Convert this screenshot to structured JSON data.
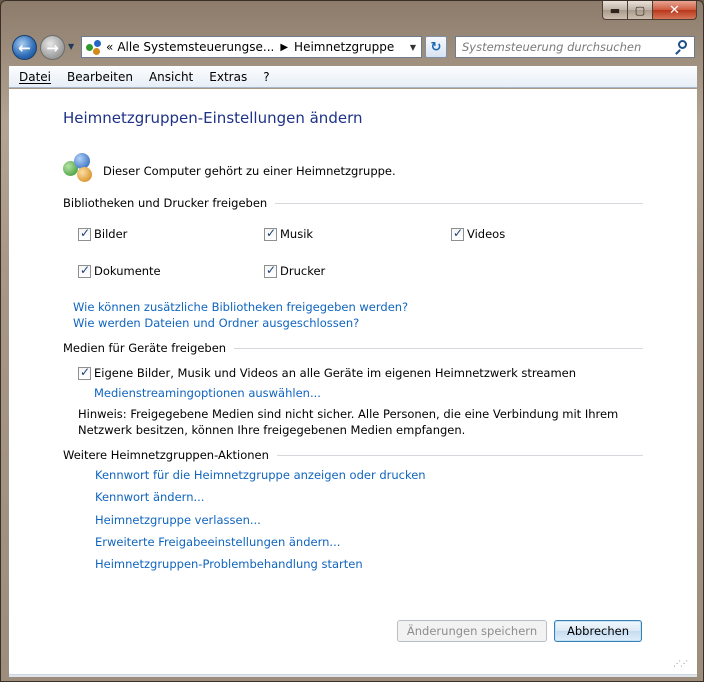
{
  "window": {
    "caption_buttons": {
      "minimize": "▬",
      "maximize": "▢",
      "close": "✕"
    }
  },
  "nav": {
    "back_icon": "←",
    "forward_icon": "→",
    "dropdown_icon": "▼",
    "address": {
      "overflow_marker": "«",
      "crumbs": [
        "Alle Systemsteuerungse...",
        "Heimnetzgruppe"
      ],
      "separator": "▶",
      "dropdown_icon": "▼"
    },
    "refresh_icon": "↻",
    "search": {
      "placeholder": "Systemsteuerung durchsuchen"
    }
  },
  "menubar": {
    "items": [
      "Datei",
      "Bearbeiten",
      "Ansicht",
      "Extras",
      "?"
    ]
  },
  "page": {
    "title": "Heimnetzgruppen-Einstellungen ändern",
    "status_text": "Dieser Computer gehört zu einer Heimnetzgruppe.",
    "sections": {
      "libraries": "Bibliotheken und Drucker freigeben",
      "media": "Medien für Geräte freigeben",
      "actions": "Weitere Heimnetzgruppen-Aktionen"
    },
    "share_items": [
      {
        "label": "Bilder",
        "checked": true
      },
      {
        "label": "Musik",
        "checked": true
      },
      {
        "label": "Videos",
        "checked": true
      },
      {
        "label": "Dokumente",
        "checked": true
      },
      {
        "label": "Drucker",
        "checked": true
      }
    ],
    "library_links": [
      "Wie können zusätzliche Bibliotheken freigegeben werden?",
      "Wie werden Dateien und Ordner ausgeschlossen?"
    ],
    "media_stream": {
      "label": "Eigene Bilder, Musik und Videos an alle Geräte im eigenen Heimnetzwerk streamen",
      "checked": true,
      "options_link": "Medienstreamingoptionen auswählen..."
    },
    "note": "Hinweis: Freigegebene Medien sind nicht sicher. Alle Personen, die eine Verbindung mit Ihrem Netzwerk besitzen, können Ihre freigegebenen Medien empfangen.",
    "action_links": [
      "Kennwort für die Heimnetzgruppe anzeigen oder drucken",
      "Kennwort ändern...",
      "Heimnetzgruppe verlassen...",
      "Erweiterte Freigabeeinstellungen ändern...",
      "Heimnetzgruppen-Problembehandlung starten"
    ],
    "buttons": {
      "save": "Änderungen speichern",
      "save_enabled": false,
      "cancel": "Abbrechen"
    }
  },
  "colors": {
    "title": "#1e3287",
    "link": "#1065be"
  }
}
